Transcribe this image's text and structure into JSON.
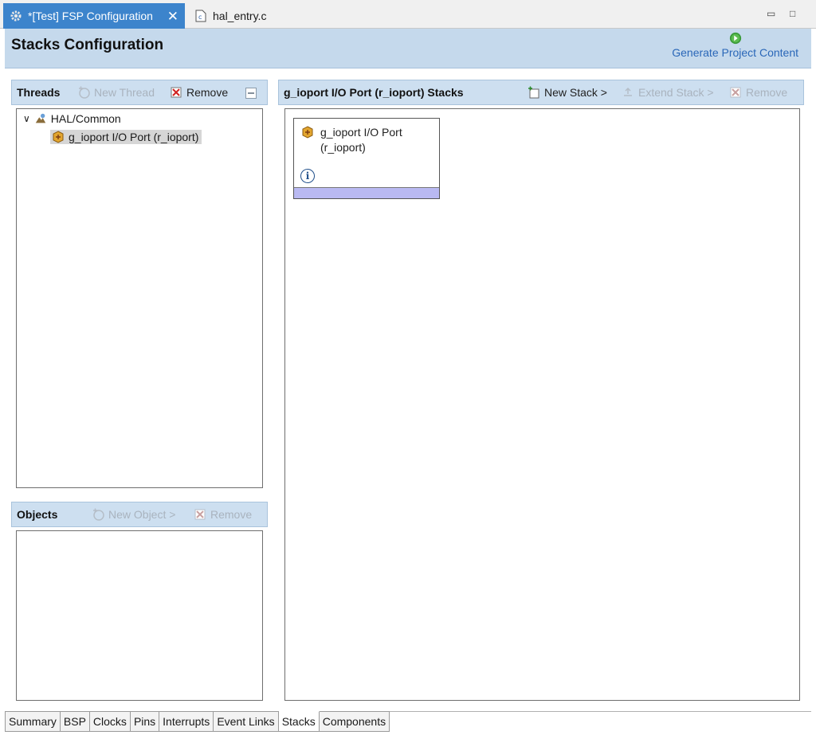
{
  "tabs": [
    {
      "label": "*[Test] FSP Configuration",
      "icon": "gear-icon",
      "active": true
    },
    {
      "label": "hal_entry.c",
      "icon": "c-file-icon",
      "active": false
    }
  ],
  "window": {
    "minimize_glyph": "▭",
    "maximize_glyph": "□"
  },
  "header": {
    "title": "Stacks Configuration",
    "generate_label": "Generate Project Content"
  },
  "threads": {
    "title": "Threads",
    "new_label": "New Thread",
    "remove_label": "Remove",
    "tree": {
      "group": "HAL/Common",
      "item": "g_ioport I/O Port (r_ioport)"
    }
  },
  "objects": {
    "title": "Objects",
    "new_label": "New Object >",
    "remove_label": "Remove"
  },
  "stacks": {
    "title": "g_ioport I/O Port (r_ioport) Stacks",
    "new_label": "New Stack >",
    "extend_label": "Extend Stack >",
    "remove_label": "Remove",
    "card": {
      "line1": "g_ioport I/O Port",
      "line2": "(r_ioport)"
    }
  },
  "bottom_tabs": [
    "Summary",
    "BSP",
    "Clocks",
    "Pins",
    "Interrupts",
    "Event Links",
    "Stacks",
    "Components"
  ],
  "active_bottom_tab": "Stacks",
  "colors": {
    "accent": "#3c84cc",
    "header_bg": "#c5d9ec",
    "card_bar": "#b9b9f2",
    "generate_icon": "#3a9a3a"
  }
}
